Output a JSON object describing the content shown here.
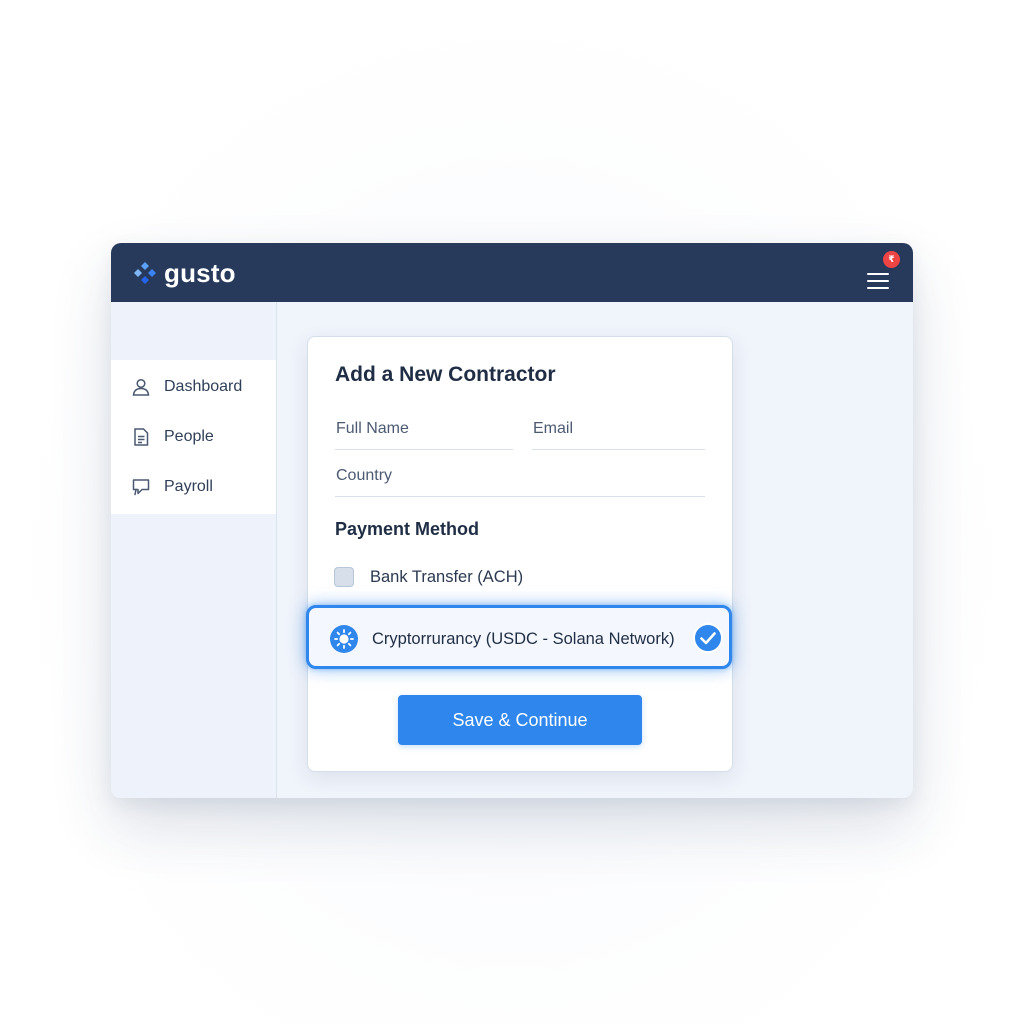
{
  "app": {
    "brand": "gusto",
    "notification_count": "₹"
  },
  "sidebar": {
    "items": [
      {
        "label": "Dashboard",
        "icon": "user-icon"
      },
      {
        "label": "People",
        "icon": "document-icon"
      },
      {
        "label": "Payroll",
        "icon": "chat-bubble-icon"
      }
    ]
  },
  "form": {
    "title": "Add a New Contractor",
    "full_name_placeholder": "Full Name",
    "email_placeholder": "Email",
    "country_placeholder": "Country",
    "payment_method_title": "Payment Method",
    "options": [
      {
        "label": "Bank Transfer (ACH)",
        "selected": false
      },
      {
        "label": "Cryptorrurancy (USDC - Solana Network)",
        "selected": true
      }
    ],
    "submit_label": "Save & Continue"
  },
  "colors": {
    "topbar": "#283a5b",
    "accent": "#2f86ec",
    "notification": "#ef4444",
    "logo_mark": "#3b82f6"
  }
}
